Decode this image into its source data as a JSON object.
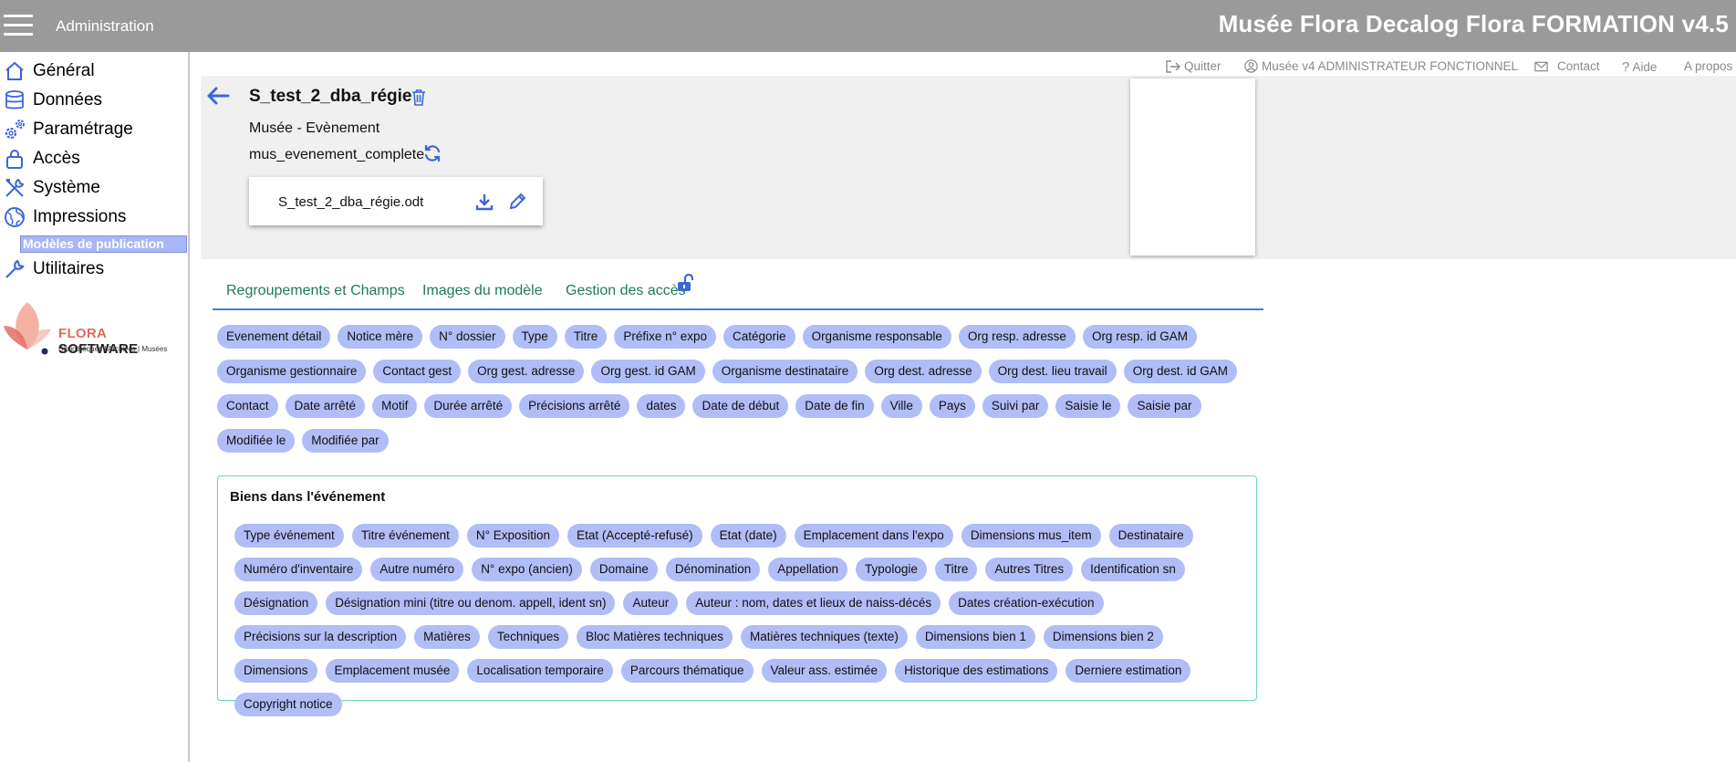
{
  "topbar": {
    "section": "Administration",
    "title": "Musée Flora Decalog Flora FORMATION v4.5"
  },
  "sidebar": {
    "items": [
      {
        "label": "Général",
        "icon": "home-icon"
      },
      {
        "label": "Données",
        "icon": "database-icon"
      },
      {
        "label": "Paramétrage",
        "icon": "gears-icon"
      },
      {
        "label": "Accès",
        "icon": "lock-icon"
      },
      {
        "label": "Système",
        "icon": "tools-icon"
      },
      {
        "label": "Impressions",
        "icon": "globe-icon"
      },
      {
        "label": "Utilitaires",
        "icon": "wrench-icon"
      }
    ],
    "active_sub": "Modèles de publication",
    "logo_brand": "FLORA",
    "logo_word": "SOFTWARE",
    "logo_tagline": "Bibliothèques | Archives | Musées"
  },
  "header_links": {
    "quit": "Quitter",
    "user": "Musée v4 ADMINISTRATEUR FONCTIONNEL",
    "contact": "Contact",
    "help": "Aide",
    "about": "A propos"
  },
  "model": {
    "name": "S_test_2_dba_régie",
    "subtitle": "Musée - Evènement",
    "code": "mus_evenement_complete",
    "file": "S_test_2_dba_régie.odt"
  },
  "tabs": [
    "Regroupements et Champs",
    "Images du modèle",
    "Gestion des accès"
  ],
  "fields": [
    "Evenement détail",
    "Notice mère",
    "N° dossier",
    "Type",
    "Titre",
    "Préfixe n° expo",
    "Catégorie",
    "Organisme responsable",
    "Org resp. adresse",
    "Org resp. id GAM",
    "Organisme gestionnaire",
    "Contact gest",
    "Org gest. adresse",
    "Org gest. id GAM",
    "Organisme destinataire",
    "Org dest. adresse",
    "Org dest. lieu travail",
    "Org dest. id GAM",
    "Contact",
    "Date arrêté",
    "Motif",
    "Durée arrêté",
    "Précisions arrêté",
    "dates",
    "Date de début",
    "Date de fin",
    "Ville",
    "Pays",
    "Suivi par",
    "Saisie le",
    "Saisie par",
    "Modifiée le",
    "Modifiée par"
  ],
  "group": {
    "title": "Biens dans l'événement",
    "fields": [
      "Type événement",
      "Titre événement",
      "N° Exposition",
      "Etat (Accepté-refusé)",
      "Etat (date)",
      "Emplacement dans l'expo",
      "Dimensions mus_item",
      "Destinataire",
      "Numéro d'inventaire",
      "Autre numéro",
      "N° expo (ancien)",
      "Domaine",
      "Dénomination",
      "Appellation",
      "Typologie",
      "Titre",
      "Autres Titres",
      "Identification sn",
      "Désignation",
      "Désignation mini (titre ou denom. appell, ident sn)",
      "Auteur",
      "Auteur : nom, dates et lieux de naiss-décés",
      "Dates création-exécution",
      "Précisions sur la description",
      "Matières",
      "Techniques",
      "Bloc Matières techniques",
      "Matières techniques (texte)",
      "Dimensions bien 1",
      "Dimensions bien 2",
      "Dimensions",
      "Emplacement musée",
      "Localisation temporaire",
      "Parcours thématique",
      "Valeur ass. estimée",
      "Historique des estimations",
      "Derniere estimation",
      "Copyright notice"
    ]
  },
  "colors": {
    "topbar": "#9a9a9a",
    "chip": "#b0bdf6",
    "accent_blue": "#4b74e3",
    "tab_text": "#1f7a5a",
    "group_border": "#6fd7ad"
  }
}
